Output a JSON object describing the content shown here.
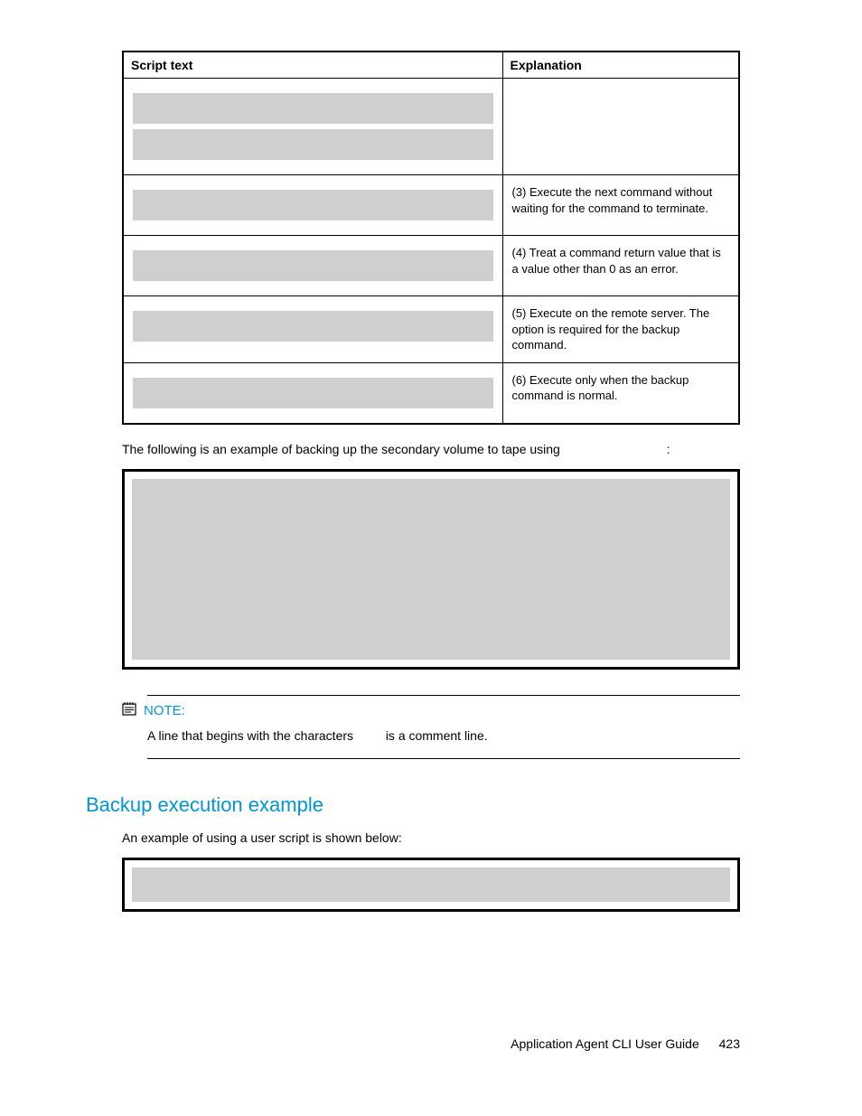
{
  "table": {
    "headers": {
      "script": "Script text",
      "explanation": "Explanation"
    },
    "rows": [
      {
        "explanation": ""
      },
      {
        "explanation": "(3) Execute the next command without waiting for the command to terminate."
      },
      {
        "explanation": "(4) Treat a command return value that is a value other than 0 as an error."
      },
      {
        "explanation": "(5) Execute on the remote server. The option is required for the backup command."
      },
      {
        "explanation": "(6) Execute only when the backup command is normal."
      }
    ]
  },
  "paragraph_after_table": {
    "before": "The following is an example of backing up the secondary volume to tape using",
    "after": ":"
  },
  "note": {
    "label": "NOTE:",
    "body_before": "A line that begins with the characters",
    "body_after": "is a comment line."
  },
  "section_heading": "Backup execution example",
  "section_intro": "An example of using a user script is shown below:",
  "footer": {
    "title": "Application Agent CLI User Guide",
    "page": "423"
  }
}
